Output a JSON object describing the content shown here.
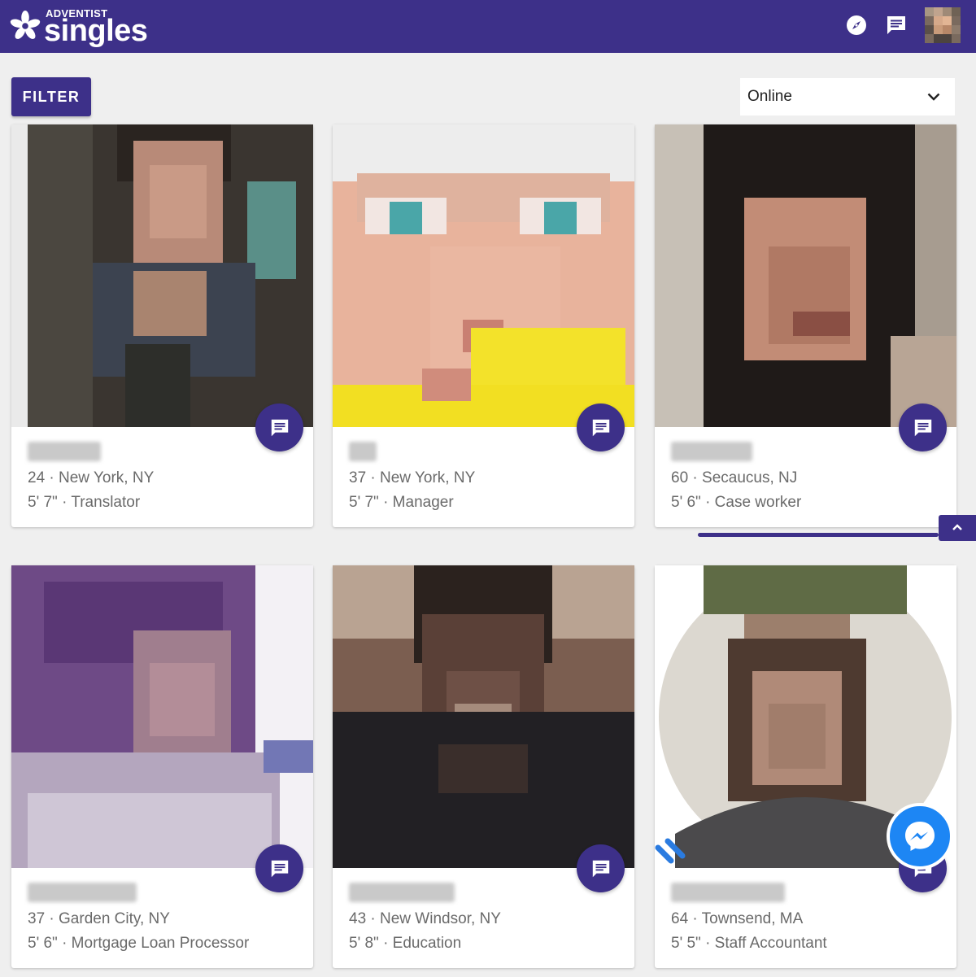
{
  "header": {
    "brand_small": "ADVENTIST",
    "brand_big": "singles",
    "icons": [
      "compass-icon",
      "chat-icon",
      "avatar"
    ]
  },
  "toolbar": {
    "filter_label": "FILTER",
    "sort_value": "Online"
  },
  "profiles": [
    {
      "line1": "24 · New York, NY",
      "line2": "5' 7\" · Translator"
    },
    {
      "line1": "37 · New York, NY",
      "line2": "5' 7\" · Manager"
    },
    {
      "line1": "60 · Secaucus, NJ",
      "line2": "5' 6\" · Case worker"
    },
    {
      "line1": "37 · Garden City, NY",
      "line2": "5' 6\" · Mortgage Loan Processor"
    },
    {
      "line1": "43 · New Windsor, NY",
      "line2": "5' 8\" · Education"
    },
    {
      "line1": "64 · Townsend, MA",
      "line2": "5' 5\" · Staff Accountant"
    }
  ],
  "colors": {
    "brand": "#3d3089",
    "background": "#efefef",
    "card": "#ffffff",
    "text_muted": "#6a6a6a",
    "messenger": "#1d86f4"
  }
}
